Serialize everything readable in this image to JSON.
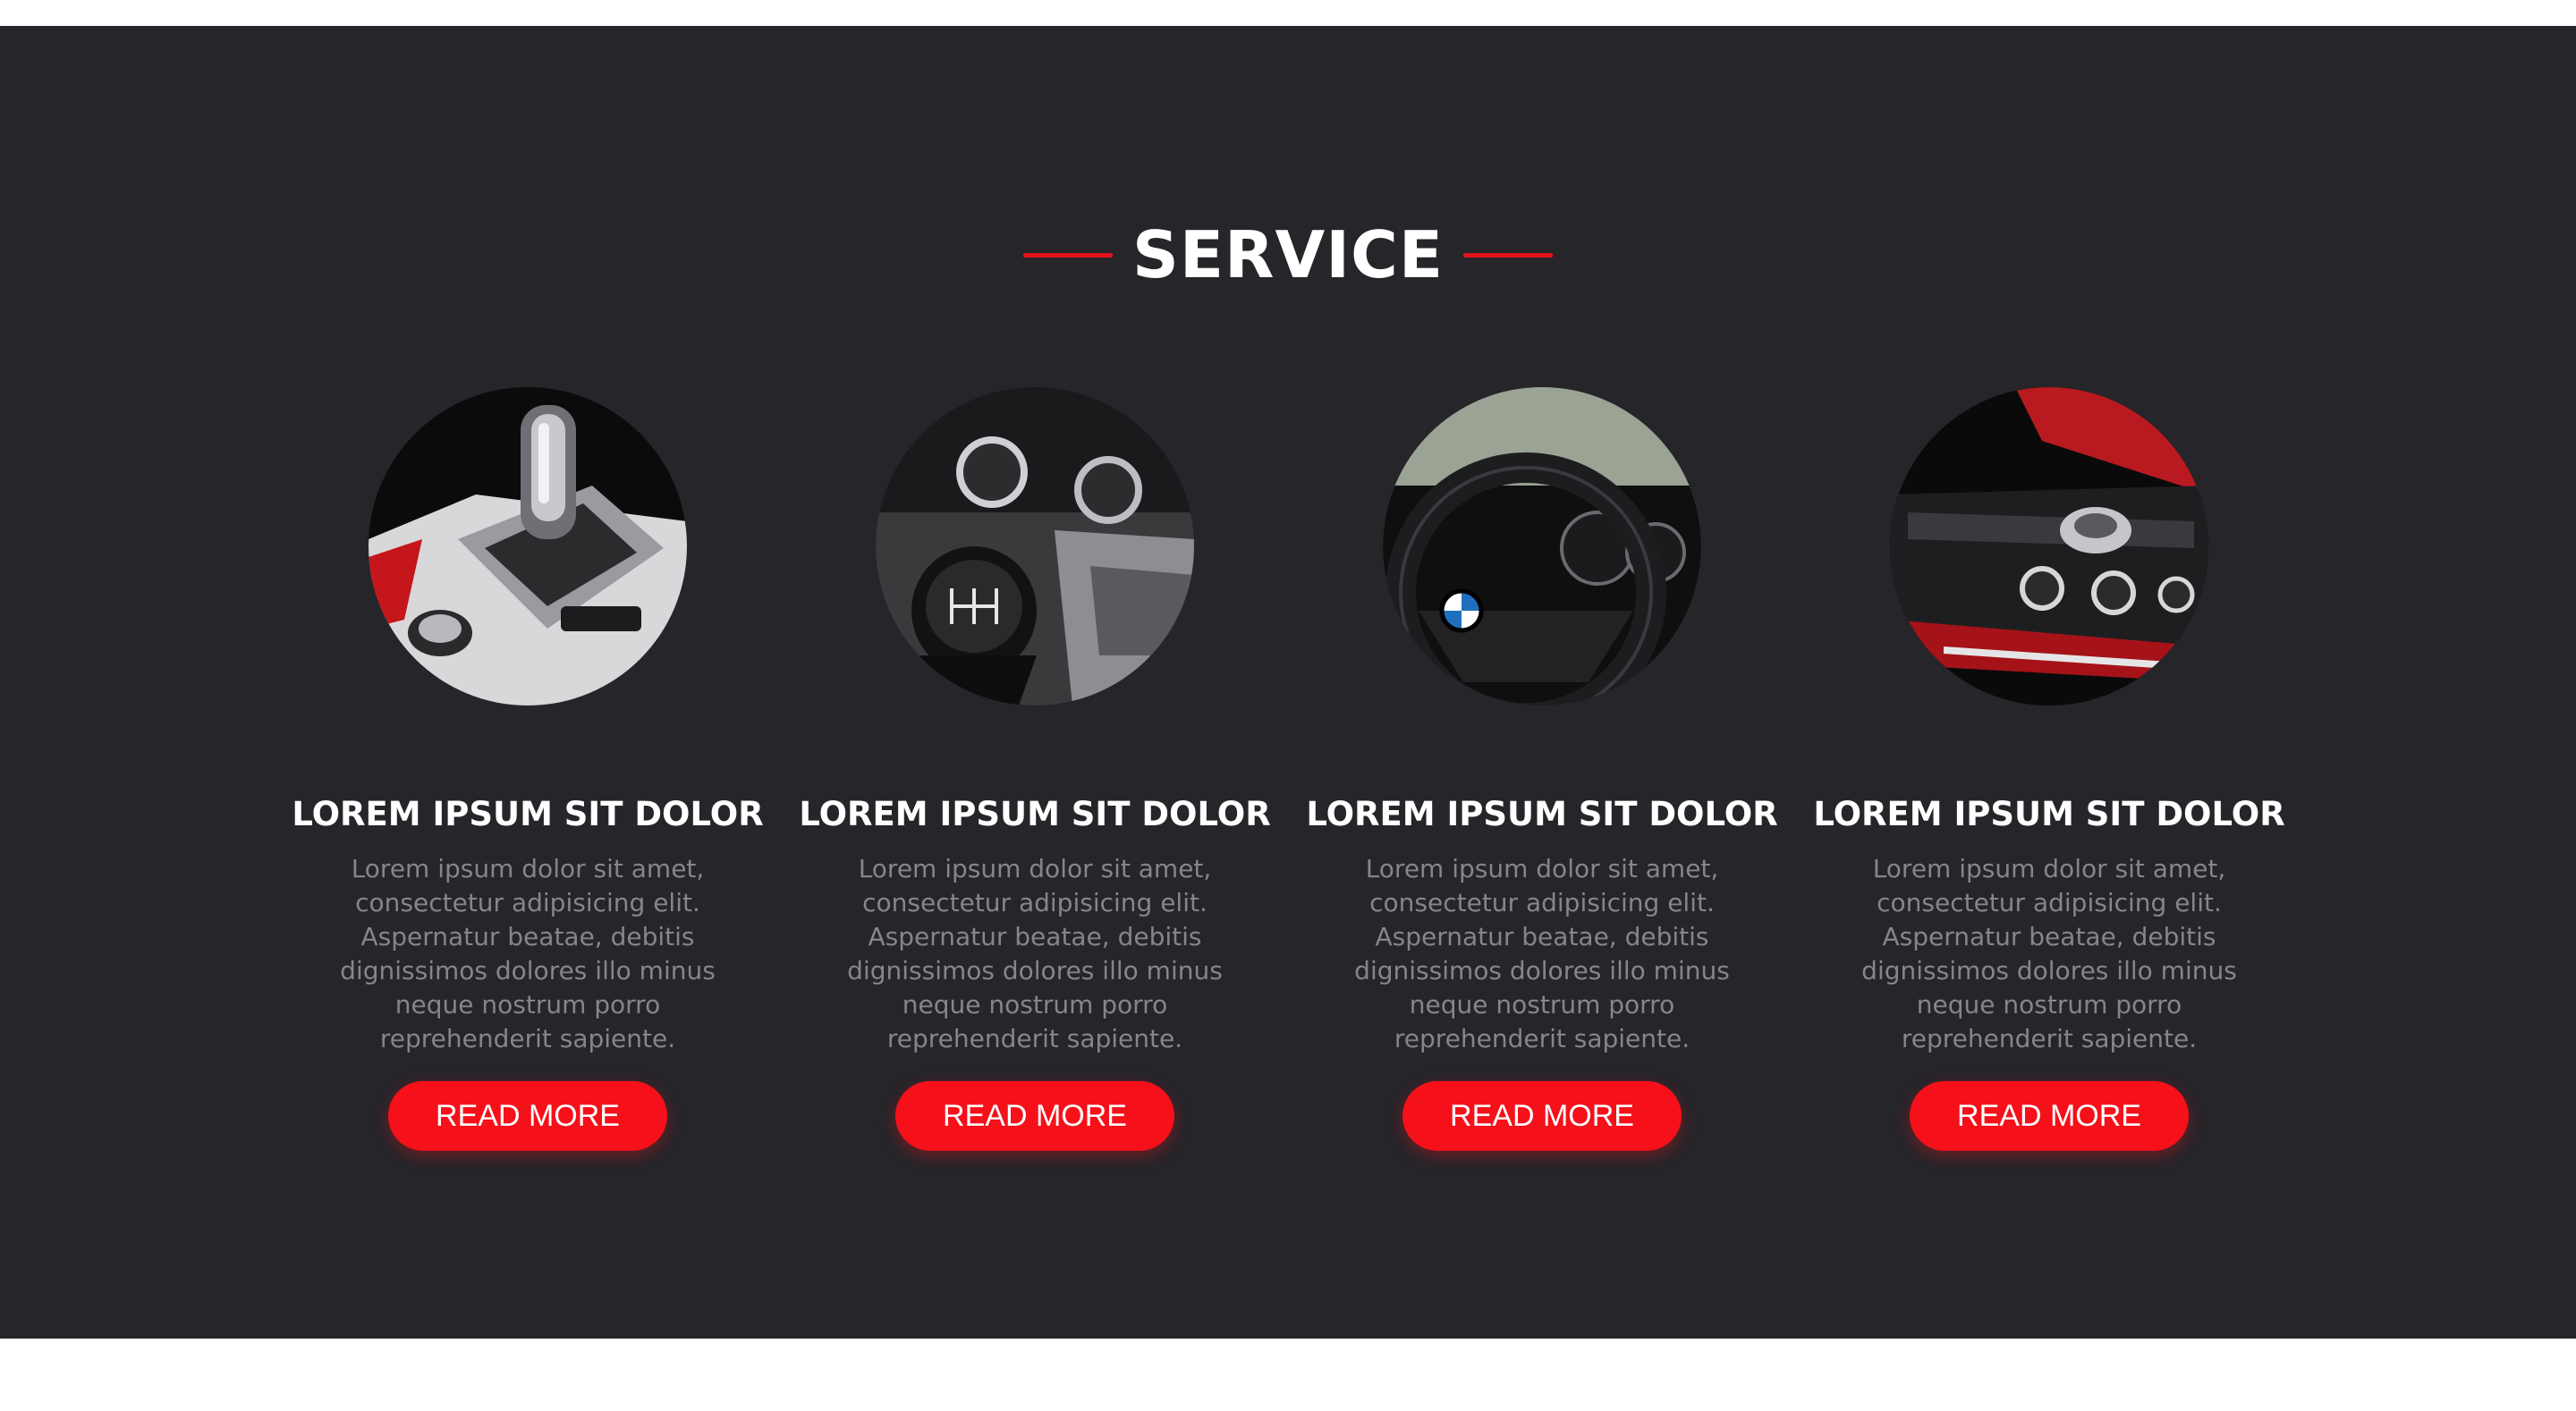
{
  "section": {
    "title": "SERVICE",
    "accent_color": "#e3141b",
    "background_color": "#25252a"
  },
  "cards": [
    {
      "image": "automatic-gear-shifter-icon",
      "title": "LOREM IPSUM SIT DOLOR",
      "text": "Lorem ipsum dolor sit amet, consectetur adipisicing elit. Aspernatur beatae, debitis dignissimos dolores illo minus neque nostrum porro reprehenderit sapiente.",
      "button": "READ MORE"
    },
    {
      "image": "manual-gear-knob-icon",
      "title": "LOREM IPSUM SIT DOLOR",
      "text": "Lorem ipsum dolor sit amet, consectetur adipisicing elit. Aspernatur beatae, debitis dignissimos dolores illo minus neque nostrum porro reprehenderit sapiente.",
      "button": "READ MORE"
    },
    {
      "image": "steering-wheel-icon",
      "title": "LOREM IPSUM SIT DOLOR",
      "text": "Lorem ipsum dolor sit amet, consectetur adipisicing elit. Aspernatur beatae, debitis dignissimos dolores illo minus neque nostrum porro reprehenderit sapiente.",
      "button": "READ MORE"
    },
    {
      "image": "center-console-icon",
      "title": "LOREM IPSUM SIT DOLOR",
      "text": "Lorem ipsum dolor sit amet, consectetur adipisicing elit. Aspernatur beatae, debitis dignissimos dolores illo minus neque nostrum porro reprehenderit sapiente.",
      "button": "READ MORE"
    }
  ],
  "button_color": "#f5101a"
}
